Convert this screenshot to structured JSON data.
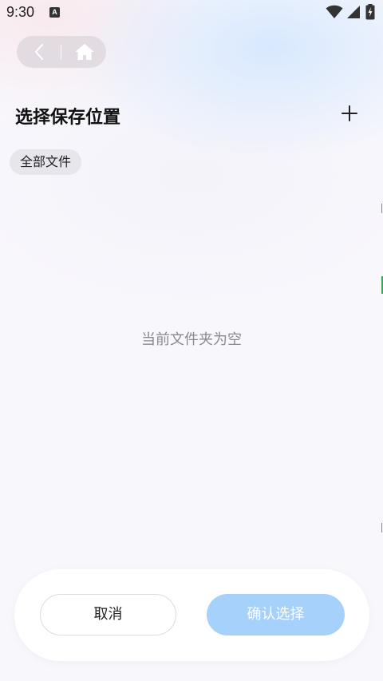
{
  "status_bar": {
    "time": "9:30",
    "notification_icon_letter": "A",
    "icons": [
      "wifi-icon",
      "signal-icon",
      "battery-charging-icon"
    ]
  },
  "nav": {
    "back_icon": "chevron-left-icon",
    "home_icon": "home-icon"
  },
  "header": {
    "title": "选择保存位置",
    "add_icon": "plus-icon"
  },
  "breadcrumb": {
    "label": "全部文件"
  },
  "empty_state": {
    "text": "当前文件夹为空"
  },
  "actions": {
    "cancel_label": "取消",
    "confirm_label": "确认选择",
    "confirm_color": "#a6d1fb"
  }
}
